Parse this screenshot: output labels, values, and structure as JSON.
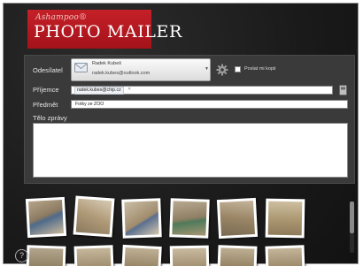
{
  "brand": {
    "company": "Ashampoo®",
    "product": "PHOTO MAILER"
  },
  "form": {
    "sender_label": "Odesílatel",
    "sender_name": "Radek Kubeš",
    "sender_email": "radek.kubes@outlook.com",
    "cc_label": "Poslat mi kopii",
    "to_label": "Příjemce",
    "to_value": "radek.kubes@chip.cz",
    "subject_label": "Předmět",
    "subject_value": "Fotky ze ZOO",
    "body_label": "Tělo zprávy",
    "body_value": ""
  },
  "help": {
    "glyph": "?"
  },
  "colors": {
    "accent": "#b3171f",
    "background": "#1e1e1e",
    "panel": "#3a3a3a"
  },
  "icons": [
    "envelope-icon",
    "gear-icon",
    "address-book-icon",
    "help-icon",
    "close-icon",
    "dropdown-arrow-icon"
  ]
}
